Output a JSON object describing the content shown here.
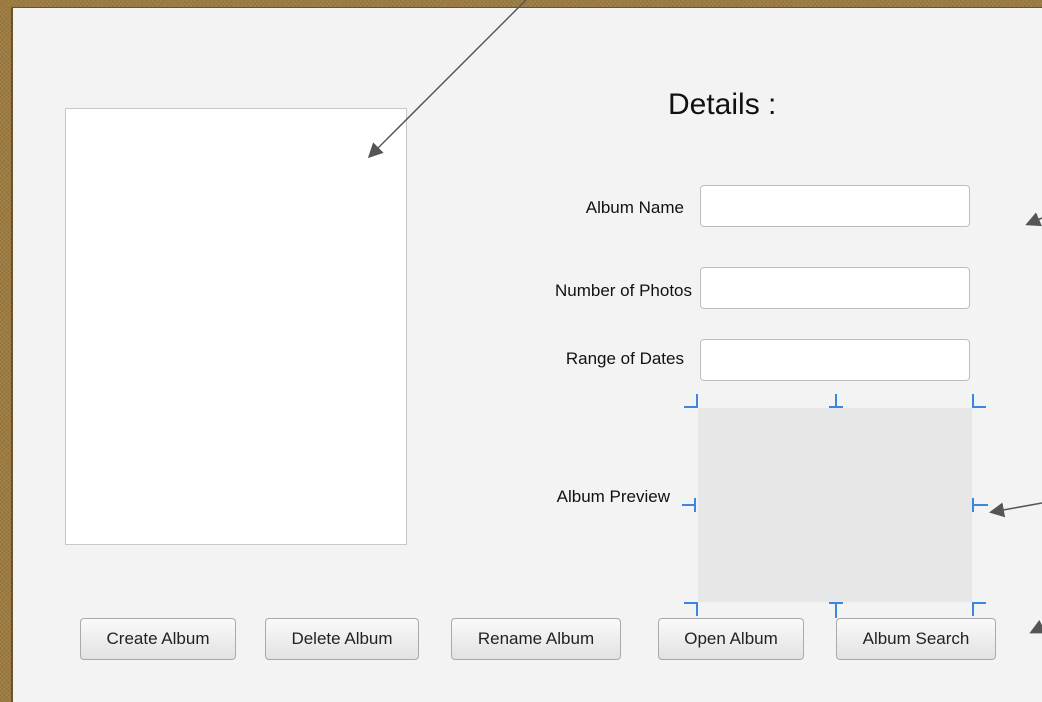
{
  "details": {
    "title": "Details :",
    "fields": [
      {
        "label": "Album Name",
        "value": ""
      },
      {
        "label": "Number of Photos",
        "value": ""
      },
      {
        "label": "Range  of Dates",
        "value": ""
      }
    ],
    "preview_label": "Album Preview"
  },
  "buttons": {
    "create": "Create Album",
    "delete": "Delete Album",
    "rename": "Rename Album",
    "open": "Open Album",
    "search": "Album Search"
  },
  "colors": {
    "frame": "#9c7b40",
    "canvas": "#f3f3f3",
    "selection_handle": "#3a86e0",
    "arrow": "#555555"
  }
}
